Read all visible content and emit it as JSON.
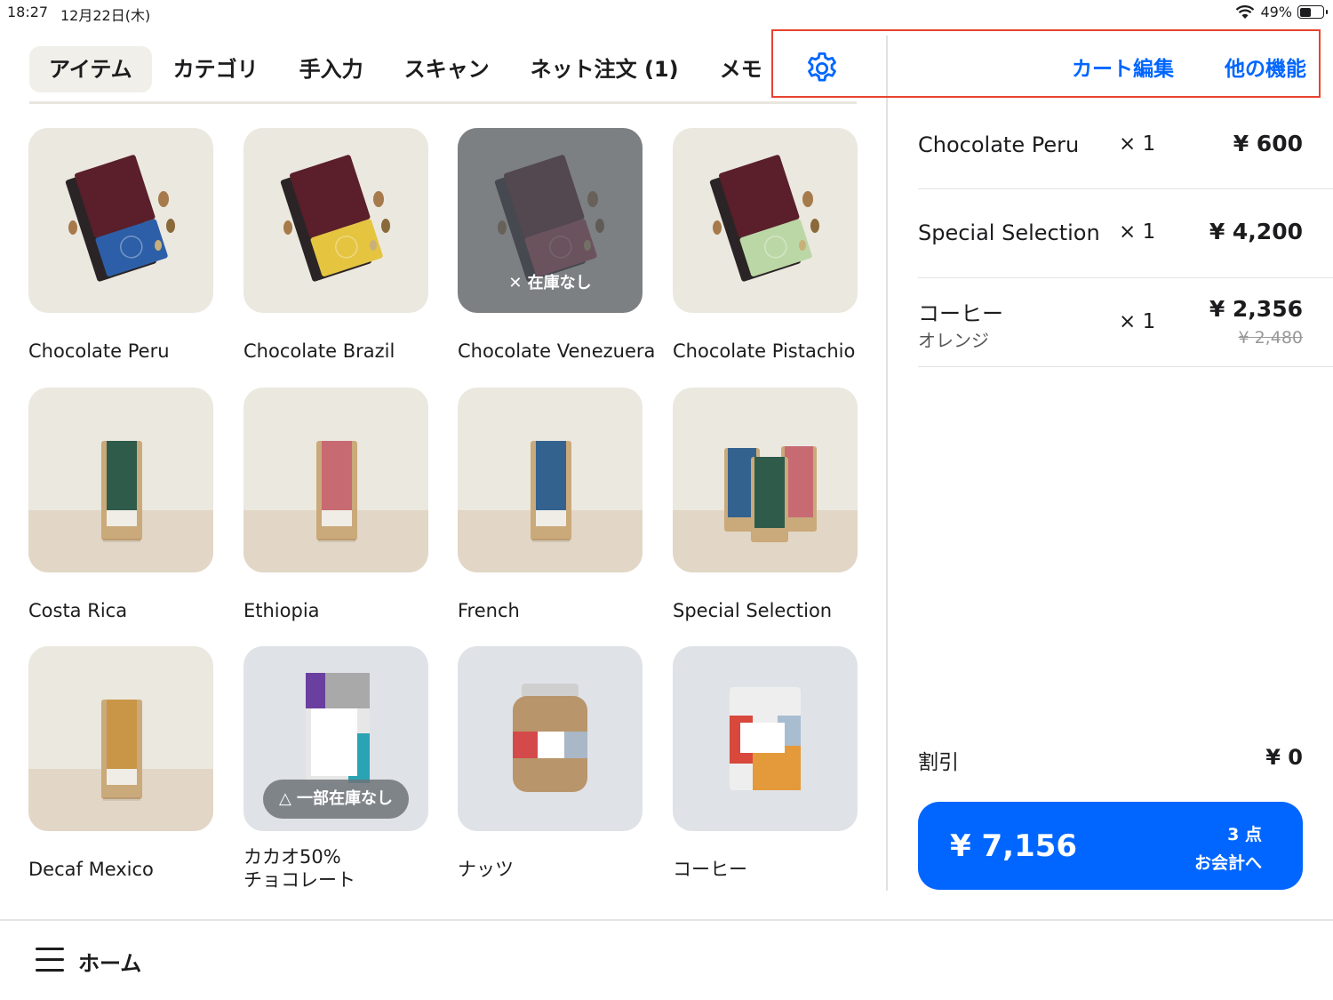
{
  "status_bar": {
    "time": "18:27",
    "date": "12月22日(木)",
    "battery": "49%",
    "battery_level": 0.49
  },
  "tabs": [
    {
      "label": "アイテム",
      "active": true
    },
    {
      "label": "カテゴリ",
      "active": false
    },
    {
      "label": "手入力",
      "active": false
    },
    {
      "label": "スキャン",
      "active": false
    },
    {
      "label": "ネット注文 (1)",
      "active": false
    },
    {
      "label": "メモ",
      "active": false
    }
  ],
  "header": {
    "settings_icon": "gear-icon",
    "cart_edit": "カート編集",
    "other_functions": "他の機能"
  },
  "items": [
    {
      "name": "Chocolate Peru",
      "image": "chocolate-bar-blue"
    },
    {
      "name": "Chocolate Brazil",
      "image": "chocolate-bar-yellow"
    },
    {
      "name": "Chocolate Venezuera",
      "image": "chocolate-bar-red",
      "overlay": "在庫なし"
    },
    {
      "name": "Chocolate Pistachio",
      "image": "chocolate-bar-green"
    },
    {
      "name": "Costa Rica",
      "image": "coffee-bag-green"
    },
    {
      "name": "Ethiopia",
      "image": "coffee-bag-pink"
    },
    {
      "name": "French",
      "image": "coffee-bag-blue"
    },
    {
      "name": "Special Selection",
      "image": "coffee-bags-trio"
    },
    {
      "name": "Decaf Mexico",
      "image": "coffee-bag-orange"
    },
    {
      "name": "カカオ50%",
      "name2": "チョコレート",
      "image": "chocolate-package",
      "overlay": "一部在庫なし"
    },
    {
      "name": "ナッツ",
      "image": "nut-jar"
    },
    {
      "name": "コーヒー",
      "image": "coffee-pouch"
    }
  ],
  "cart": {
    "lines": [
      {
        "name": "Chocolate Peru",
        "qty": "× 1",
        "price": "¥ 600"
      },
      {
        "name": "Special Selection",
        "qty": "× 1",
        "price": "¥ 4,200"
      },
      {
        "name": "コーヒー",
        "variant": "オレンジ",
        "qty": "× 1",
        "price": "¥ 2,356",
        "original_price": "¥ 2,480"
      }
    ],
    "discount_label": "割引",
    "discount_value": "¥ 0",
    "total": "¥ 7,156",
    "item_count": "3 点",
    "checkout_label": "お会計へ"
  },
  "bottom_nav": {
    "menu_icon": "hamburger-menu-icon",
    "label": "ホーム"
  },
  "colors": {
    "accent": "#0066ff",
    "highlight": "#e8432f",
    "card_bg": "#ebe8df"
  }
}
